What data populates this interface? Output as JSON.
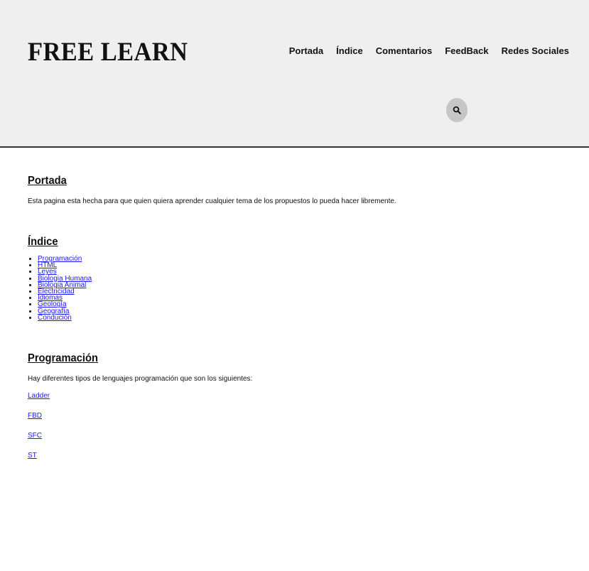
{
  "header": {
    "logo": "FREE LEARN",
    "nav": [
      "Portada",
      "Índice",
      "Comentarios",
      "FeedBack",
      "Redes Sociales"
    ],
    "search_icon": "search-icon"
  },
  "portada": {
    "title": "Portada",
    "text": "Esta pagina esta hecha para que quien quiera aprender cualquier tema de los propuestos lo pueda hacer libremente."
  },
  "indice": {
    "title": "Índice",
    "items": [
      "Programación",
      "HTML",
      "Leyes",
      "Biologia Humana",
      "Biologia Animal",
      "Electricidad",
      "Idiomas",
      "Geología",
      "Geografía",
      "Condución"
    ]
  },
  "programacion": {
    "title": "Programación",
    "text": "Hay diferentes tipos de lenguajes programación que son los siguientes:",
    "links": [
      "Ladder",
      "FBD",
      "SFC",
      "ST"
    ]
  },
  "colors": {
    "header_bg": "#efefef",
    "link": "#1a1aee",
    "search_bg": "#c6c6c6"
  }
}
